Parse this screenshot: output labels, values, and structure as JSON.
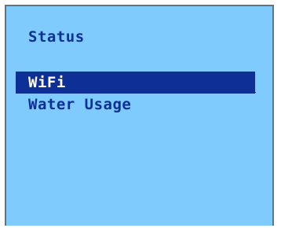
{
  "screen": {
    "title": "Status",
    "menu": {
      "items": [
        {
          "label": "WiFi",
          "selected": true
        },
        {
          "label": "Water Usage",
          "selected": false
        }
      ]
    }
  },
  "colors": {
    "background": "#7fcbfd",
    "text": "#0e2f96",
    "highlight": "#0e2f96",
    "highlight_text": "#ffffff",
    "frame": "#707070"
  }
}
